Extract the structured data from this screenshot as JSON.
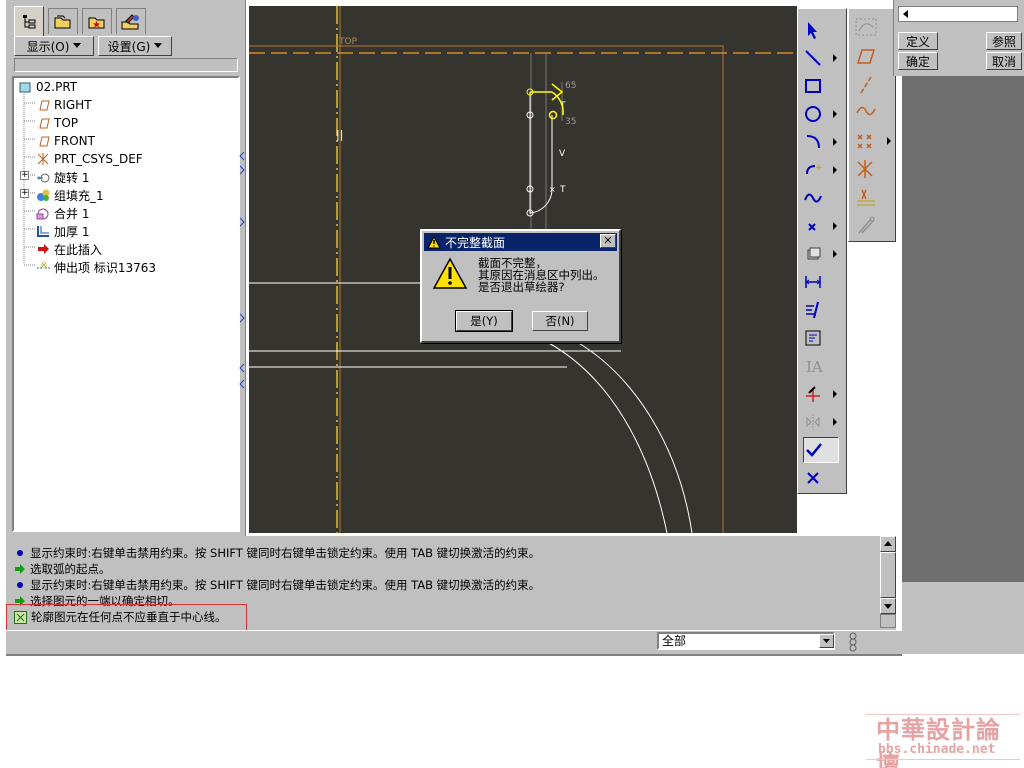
{
  "navigator": {
    "show_menu": "显示(O)",
    "settings_menu": "设置(G)",
    "tree": [
      {
        "label": "02.PRT",
        "icon": "part-icon"
      },
      {
        "label": "RIGHT",
        "icon": "datum-plane-icon"
      },
      {
        "label": "TOP",
        "icon": "datum-plane-icon"
      },
      {
        "label": "FRONT",
        "icon": "datum-plane-icon"
      },
      {
        "label": "PRT_CSYS_DEF",
        "icon": "csys-icon"
      },
      {
        "label": "旋转 1",
        "icon": "revolve-icon"
      },
      {
        "label": "组填充_1",
        "icon": "group-icon"
      },
      {
        "label": "合并 1",
        "icon": "merge-icon"
      },
      {
        "label": "加厚 1",
        "icon": "thicken-icon"
      },
      {
        "label": "在此插入",
        "icon": "insert-arrow-icon"
      },
      {
        "label": "伸出项 标识13763",
        "icon": "protrusion-icon"
      }
    ]
  },
  "graphics": {
    "datum_label_top": "TOP",
    "dimensions": [
      "65",
      "35",
      "T",
      "T",
      "V"
    ]
  },
  "dialog": {
    "title": "不完整截面",
    "line1": "截面不完整，",
    "line2": "其原因在消息区中列出。",
    "line3": "是否退出草绘器?",
    "yes_label": "是(Y)",
    "no_label": "否(N)",
    "close_label": "✕"
  },
  "dashboard": {
    "define_label": "定义",
    "refs_label": "参照",
    "ok_label": "确定",
    "cancel_label": "取消"
  },
  "messages": [
    {
      "icon": "bullet",
      "text": "显示约束时:右键单击禁用约束。按 SHIFT 键同时右键单击锁定约束。使用 TAB 键切换激活的约束。"
    },
    {
      "icon": "prompt-arrow",
      "text": "选取弧的起点。"
    },
    {
      "icon": "bullet",
      "text": "显示约束时:右键单击禁用约束。按 SHIFT 键同时右键单击锁定约束。使用 TAB 键切换激活的约束。"
    },
    {
      "icon": "prompt-arrow",
      "text": "选择图元的一端以确定相切。"
    },
    {
      "icon": "error-icon",
      "text": "轮廓图元在任何点不应垂直于中心线。"
    }
  ],
  "status": {
    "filter_value": "全部"
  },
  "watermark": {
    "title": "中華設計論壇",
    "url": "bbs.chinade.net"
  },
  "colors": {
    "graphics_bg": "#36342f",
    "sketch_yellow": "#ffff00",
    "datum_orange": "#d08a2a",
    "dialog_title": "#0a246a",
    "error_box": "#e03030"
  }
}
